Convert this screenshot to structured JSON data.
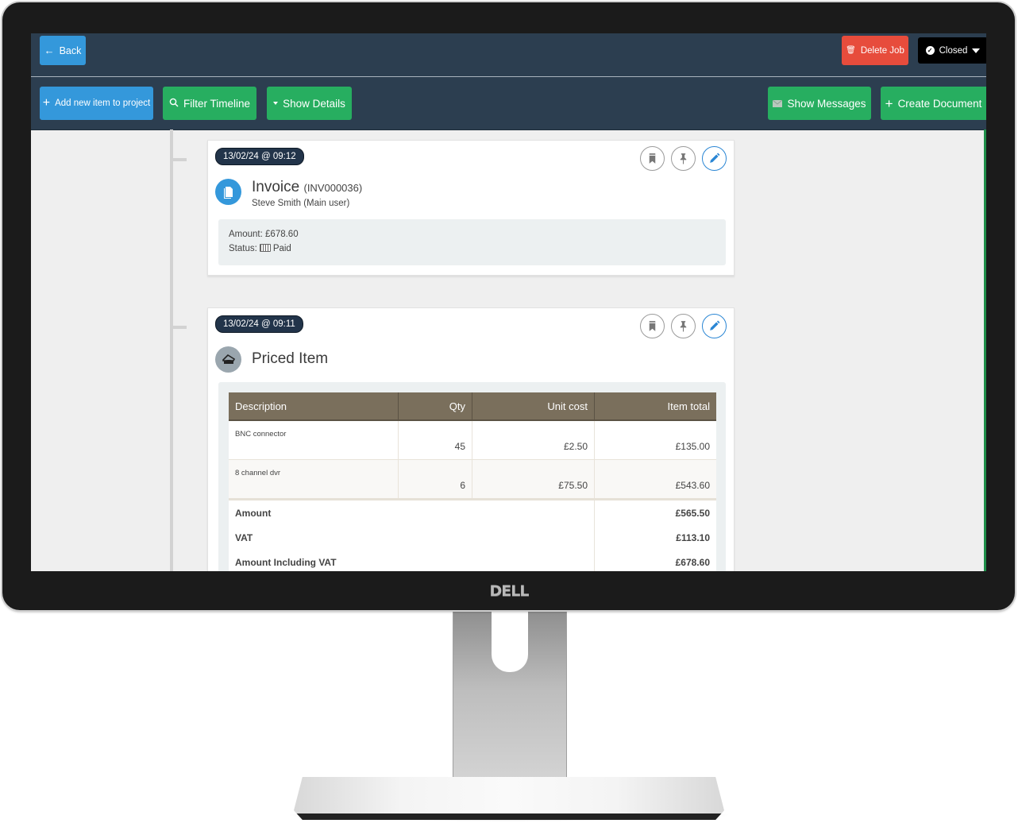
{
  "device": {
    "brand_logo": "DELL"
  },
  "header": {
    "back_label": "Back",
    "delete_label": "Delete Job",
    "status_label": "Closed",
    "colors": {
      "primary": "#3498db",
      "success": "#27ae60",
      "danger": "#e74c3c",
      "navbar": "#2c3e50"
    }
  },
  "toolbar": {
    "add_item_label": "Add new item to project",
    "filter_label": "Filter Timeline",
    "details_label": "Show Details",
    "messages_label": "Show Messages",
    "create_doc_label": "Create Document"
  },
  "timeline": [
    {
      "datetime": "13/02/24 @ 09:12",
      "type": "Invoice",
      "reference": "(INV000036)",
      "author": "Steve Smith (Main user)",
      "amount_label": "Amount:",
      "amount": "£678.60",
      "status_label": "Status:",
      "status": "Paid"
    },
    {
      "datetime": "13/02/24 @ 09:11",
      "type": "Priced Item",
      "table": {
        "headers": [
          "Description",
          "Qty",
          "Unit cost",
          "Item total"
        ],
        "rows": [
          {
            "description": "BNC connector",
            "qty": "45",
            "unit_cost": "£2.50",
            "item_total": "£135.00"
          },
          {
            "description": "8 channel dvr",
            "qty": "6",
            "unit_cost": "£75.50",
            "item_total": "£543.60"
          }
        ],
        "summary": [
          {
            "label": "Amount",
            "value": "£565.50"
          },
          {
            "label": "VAT",
            "value": "£113.10"
          },
          {
            "label": "Amount Including VAT",
            "value": "£678.60"
          }
        ]
      }
    }
  ]
}
